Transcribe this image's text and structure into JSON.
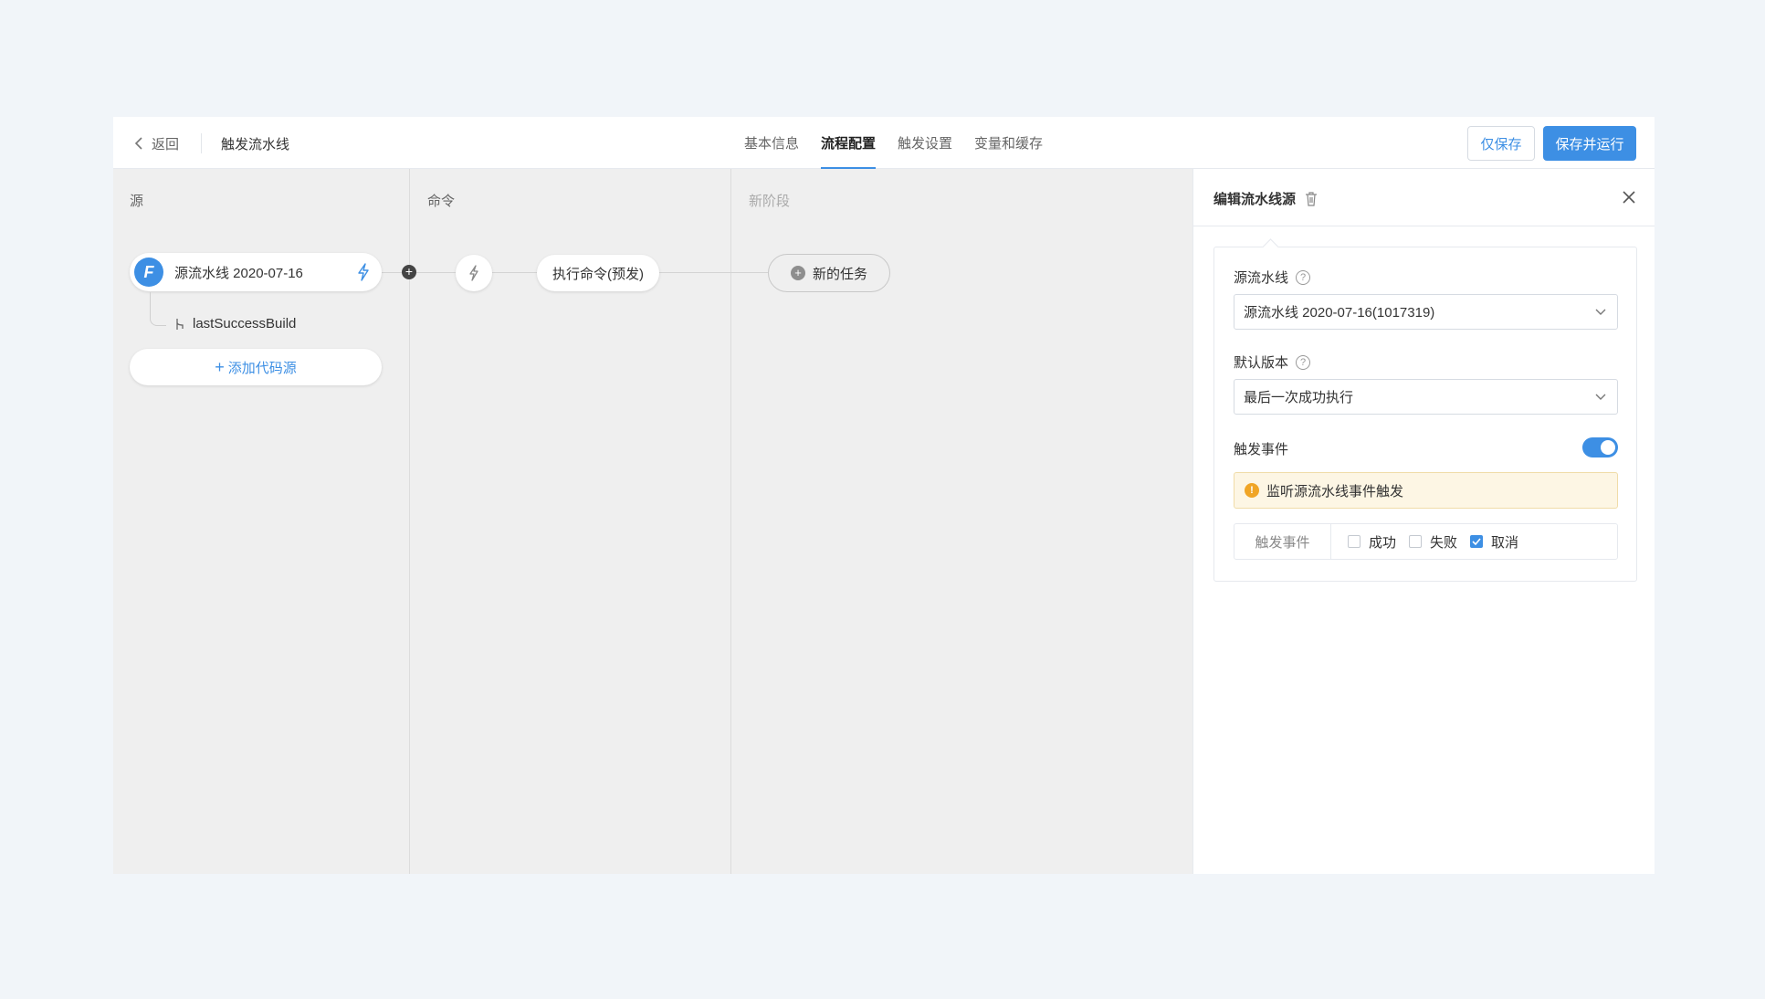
{
  "header": {
    "back_label": "返回",
    "title": "触发流水线",
    "tabs": [
      {
        "label": "基本信息",
        "active": false
      },
      {
        "label": "流程配置",
        "active": true
      },
      {
        "label": "触发设置",
        "active": false
      },
      {
        "label": "变量和缓存",
        "active": false
      }
    ],
    "save_label": "仅保存",
    "save_run_label": "保存并运行"
  },
  "canvas": {
    "columns": [
      {
        "title": "源"
      },
      {
        "title": "命令"
      },
      {
        "title": "新阶段"
      }
    ],
    "source": {
      "logo_letter": "F",
      "name": "源流水线 2020-07-16",
      "branch": "lastSuccessBuild",
      "add_label": "添加代码源"
    },
    "task_label": "执行命令(预发)",
    "new_task_label": "新的任务"
  },
  "panel": {
    "title": "编辑流水线源",
    "source_pipeline_label": "源流水线",
    "source_pipeline_value": "源流水线 2020-07-16(1017319)",
    "default_version_label": "默认版本",
    "default_version_value": "最后一次成功执行",
    "trigger_event_label": "触发事件",
    "trigger_enabled": true,
    "notice": "监听源流水线事件触发",
    "events_label": "触发事件",
    "events": [
      {
        "label": "成功",
        "checked": false
      },
      {
        "label": "失败",
        "checked": false
      },
      {
        "label": "取消",
        "checked": true
      }
    ]
  },
  "colors": {
    "accent": "#3d8fe4",
    "canvas_bg": "#efefef",
    "page_bg": "#f1f5f9",
    "notice_bg": "#fdf6e4"
  }
}
